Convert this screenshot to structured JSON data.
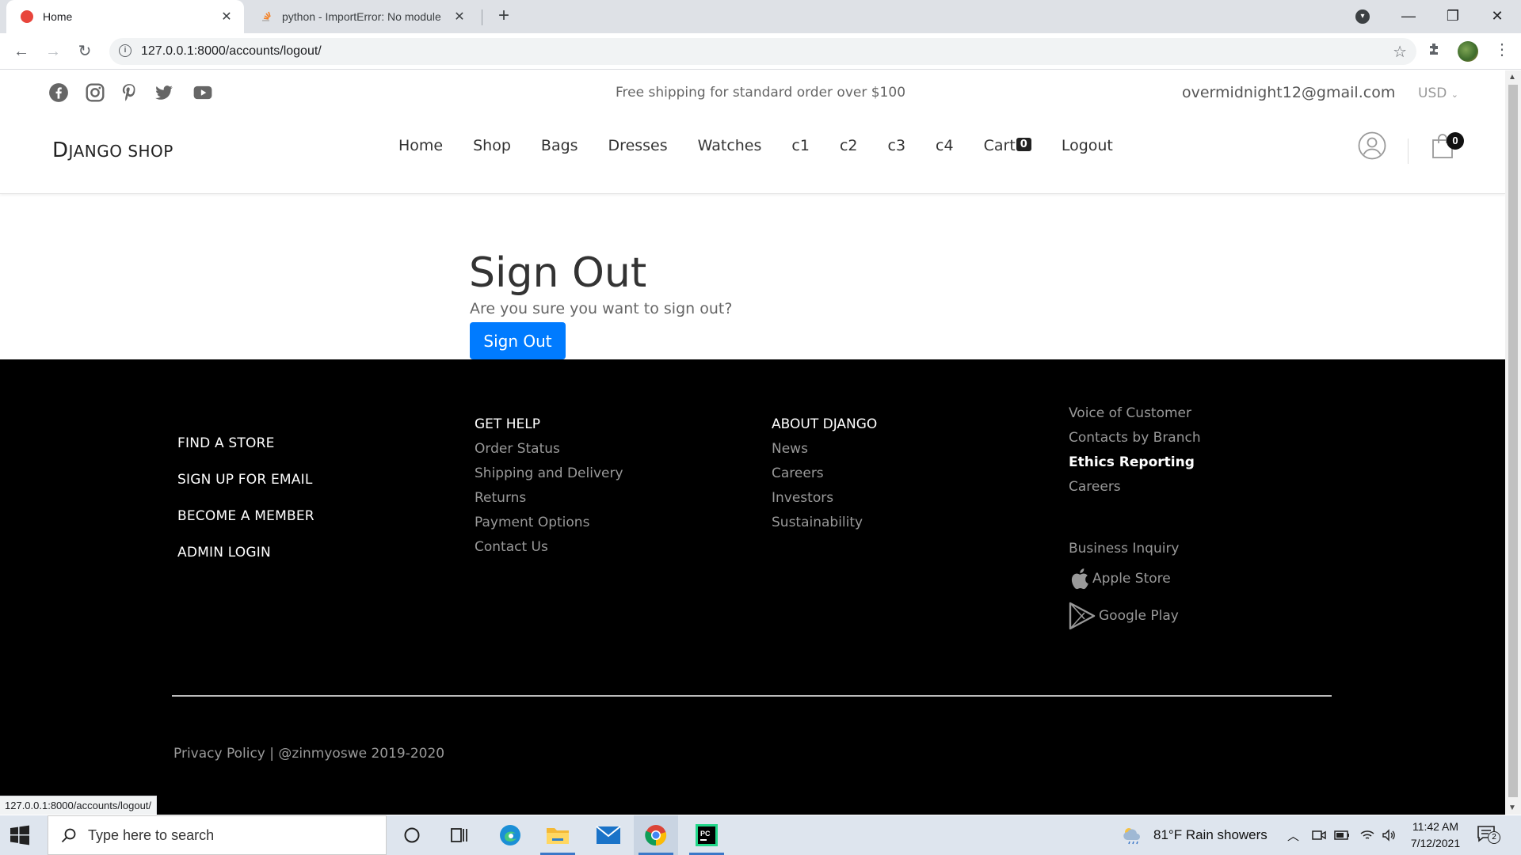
{
  "browser": {
    "tabs": [
      {
        "title": "Home",
        "active": true
      },
      {
        "title": "python - ImportError: No module",
        "active": false
      }
    ],
    "new_tab_label": "+",
    "url": "127.0.0.1:8000/accounts/logout/",
    "status_url": "127.0.0.1:8000/accounts/logout/"
  },
  "topbar": {
    "social_icons": [
      "facebook-icon",
      "instagram-icon",
      "pinterest-icon",
      "twitter-icon",
      "youtube-icon"
    ],
    "shipping_note": "Free shipping for standard order over $100",
    "user_email": "overmidnight12@gmail.com",
    "currency": "USD"
  },
  "header": {
    "logo_initial": "D",
    "logo_rest": "JANGO SHOP",
    "nav": [
      "Home",
      "Shop",
      "Bags",
      "Dresses",
      "Watches",
      "c1",
      "c2",
      "c3",
      "c4"
    ],
    "cart_label": "Cart",
    "cart_count": "0",
    "logout_label": "Logout",
    "bag_count": "0"
  },
  "signout": {
    "title": "Sign Out",
    "question": "Are you sure you want to sign out?",
    "button": "Sign Out"
  },
  "footer": {
    "col1": [
      "FIND A STORE",
      "SIGN UP FOR EMAIL",
      "BECOME A MEMBER",
      "ADMIN LOGIN"
    ],
    "col2": {
      "heading": "GET HELP",
      "links": [
        "Order Status",
        "Shipping and Delivery",
        "Returns",
        "Payment Options",
        "Contact Us"
      ]
    },
    "col3": {
      "heading": "ABOUT DJANGO",
      "links": [
        "News",
        "Careers",
        "Investors",
        "Sustainability"
      ]
    },
    "col4": {
      "links_top": [
        "Voice of Customer",
        "Contacts by Branch"
      ],
      "highlight": "Ethics Reporting",
      "links_mid": [
        "Careers"
      ],
      "business": "Business Inquiry",
      "apple": "Apple Store",
      "google": "Google Play"
    },
    "copyright": "Privacy Policy | @zinmyoswe 2019-2020"
  },
  "taskbar": {
    "search_placeholder": "Type here to search",
    "weather": "81°F  Rain showers",
    "time": "11:42 AM",
    "date": "7/12/2021",
    "notification_count": "2"
  },
  "colors": {
    "primary_button": "#007bff",
    "footer_bg": "#000000",
    "chrome_tabstrip": "#dee1e6"
  }
}
